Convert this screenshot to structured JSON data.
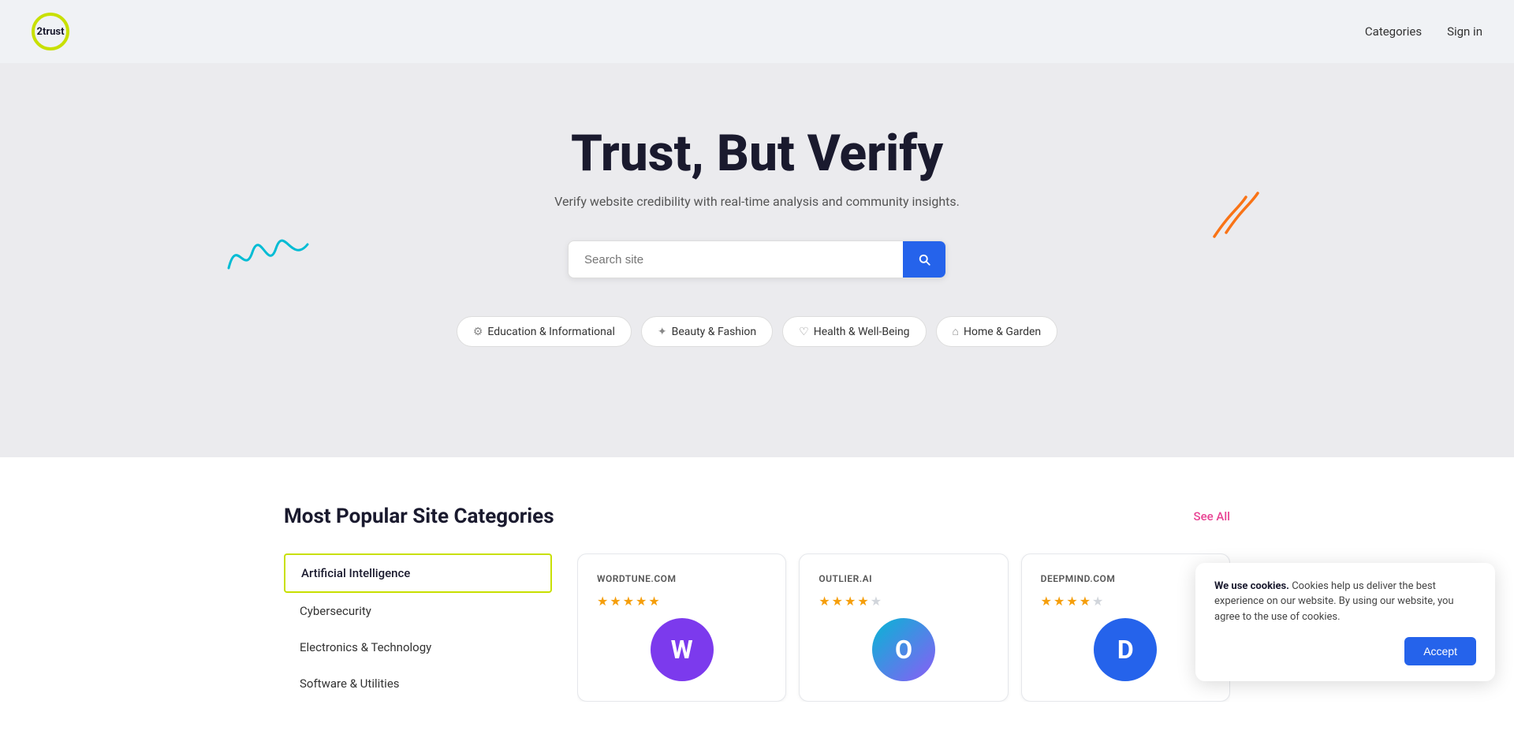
{
  "header": {
    "logo_text": "2trust",
    "nav": {
      "categories_label": "Categories",
      "signin_label": "Sign in"
    }
  },
  "hero": {
    "title": "Trust, But Verify",
    "subtitle": "Verify website credibility with real-time analysis and community insights.",
    "search_placeholder": "Search site",
    "search_button_label": "Search",
    "category_pills": [
      {
        "icon": "⚙",
        "label": "Education & Informational"
      },
      {
        "icon": "✦",
        "label": "Beauty & Fashion"
      },
      {
        "icon": "♡",
        "label": "Health & Well-Being"
      },
      {
        "icon": "⌂",
        "label": "Home & Garden"
      }
    ]
  },
  "popular_section": {
    "title": "Most Popular Site Categories",
    "see_all_label": "See All",
    "categories": [
      {
        "label": "Artificial Intelligence",
        "active": true
      },
      {
        "label": "Cybersecurity",
        "active": false
      },
      {
        "label": "Electronics & Technology",
        "active": false
      },
      {
        "label": "Software & Utilities",
        "active": false
      }
    ],
    "site_cards": [
      {
        "domain": "WORDTUNE.COM",
        "stars": 5,
        "logo_letter": "W",
        "logo_class": "wordtune-logo"
      },
      {
        "domain": "OUTLIER.AI",
        "stars": 4.5,
        "logo_letter": "O",
        "logo_class": "outlier-logo"
      },
      {
        "domain": "DEEPMIND.COM",
        "stars": 4,
        "logo_letter": "D",
        "logo_class": "deepmind-logo"
      }
    ]
  },
  "cookie_banner": {
    "bold_text": "We use cookies.",
    "description": " Cookies help us deliver the best experience on our website. By using our website, you agree to the use of cookies.",
    "accept_label": "Accept"
  }
}
